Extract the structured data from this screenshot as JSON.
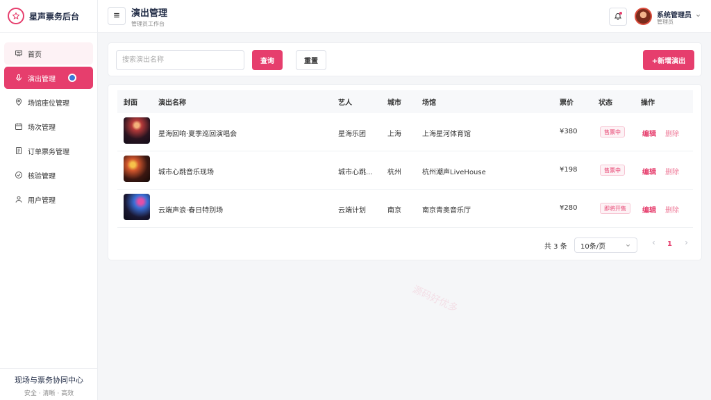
{
  "brand": {
    "title": "星声票务后台"
  },
  "sidebar": {
    "items": [
      {
        "label": "首页",
        "icon": "presentation-icon"
      },
      {
        "label": "演出管理",
        "icon": "microphone-icon"
      },
      {
        "label": "场馆座位管理",
        "icon": "location-pin-icon"
      },
      {
        "label": "场次管理",
        "icon": "calendar-icon"
      },
      {
        "label": "订单票务管理",
        "icon": "document-icon"
      },
      {
        "label": "核验管理",
        "icon": "check-circle-icon"
      },
      {
        "label": "用户管理",
        "icon": "user-icon"
      }
    ],
    "active_index": 1,
    "footer_title": "现场与票务协同中心",
    "footer_sub": "安全 · 清晰 · 高效"
  },
  "header": {
    "title": "演出管理",
    "subtitle": "管理员工作台",
    "user_name": "系统管理员",
    "user_role": "管理员"
  },
  "search": {
    "placeholder": "搜索演出名称",
    "value": "",
    "query_label": "查询",
    "reset_label": "重置",
    "add_label": "+新增演出"
  },
  "table": {
    "columns": [
      "封面",
      "演出名称",
      "艺人",
      "城市",
      "场馆",
      "票价",
      "状态",
      "操作"
    ],
    "rows": [
      {
        "name": "星海回响·夏季巡回演唱会",
        "artist": "星海乐团",
        "city": "上海",
        "venue": "上海星河体育馆",
        "price": "¥380",
        "status": "售票中",
        "edit": "编辑",
        "delete": "删除"
      },
      {
        "name": "城市心跳音乐现场",
        "artist": "城市心跳...",
        "city": "杭州",
        "venue": "杭州潮声LiveHouse",
        "price": "¥198",
        "status": "售票中",
        "edit": "编辑",
        "delete": "删除"
      },
      {
        "name": "云端声浪·春日特别场",
        "artist": "云端计划",
        "city": "南京",
        "venue": "南京青奥音乐厅",
        "price": "¥280",
        "status": "即将开售",
        "edit": "编辑",
        "delete": "删除"
      }
    ]
  },
  "pagination": {
    "total": "共 3 条",
    "page_size": "10条/页",
    "current": "1"
  },
  "watermark": "源码好优多",
  "colors": {
    "accent": "#e63e6d",
    "text": "#1f2a44"
  }
}
